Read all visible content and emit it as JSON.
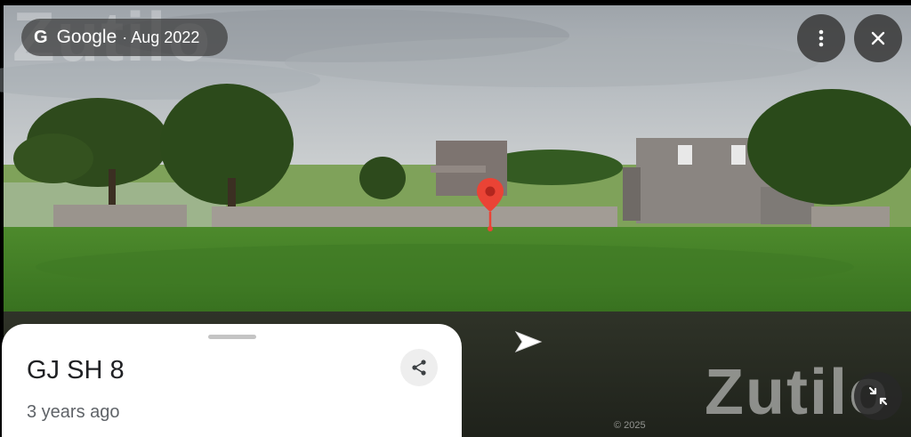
{
  "attribution": {
    "logo_letter": "G",
    "brand": "Google",
    "separator": "·",
    "date": "Aug 2022"
  },
  "watermark": {
    "top": "Zutilo",
    "bottom": "Zutilo"
  },
  "copyright": "© 2025",
  "toolbar": {
    "more_icon": "more-vert-icon",
    "close_icon": "close-icon",
    "collapse_icon": "collapse-icon"
  },
  "navigation": {
    "arrow_icon": "forward-arrow-icon"
  },
  "place_card": {
    "title": "GJ SH 8",
    "subtitle": "3 years ago",
    "share_icon": "share-icon"
  },
  "colors": {
    "pin": "#ea4335",
    "card_bg": "#ffffff",
    "control_bg": "#373737"
  }
}
